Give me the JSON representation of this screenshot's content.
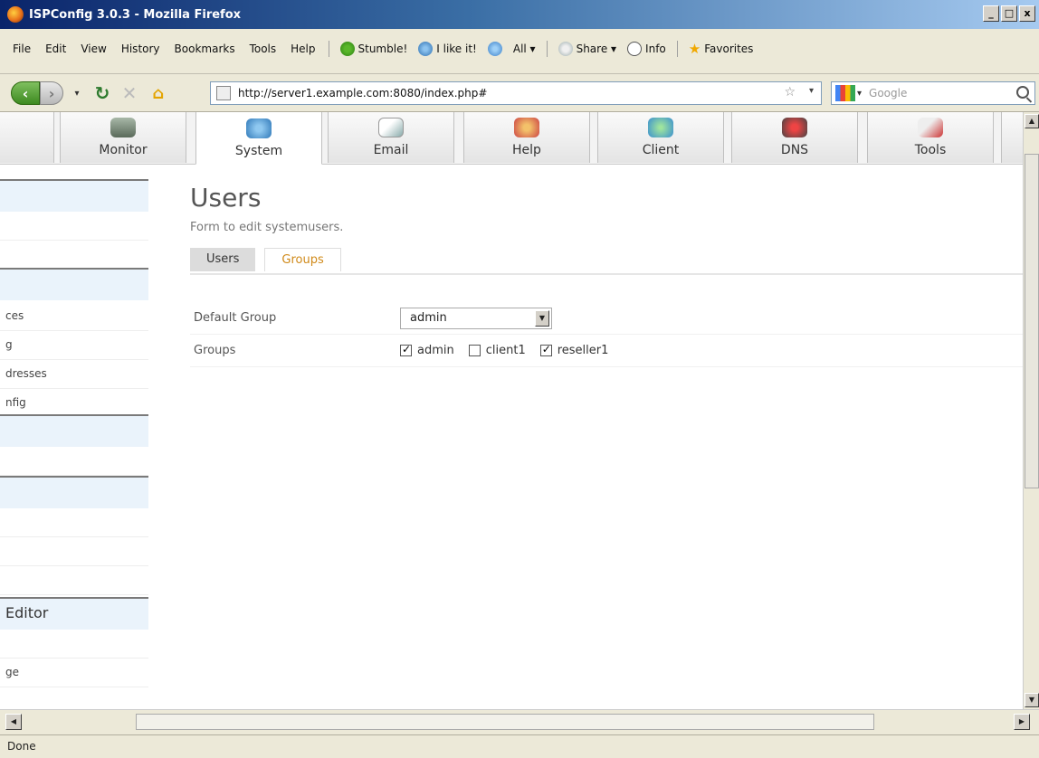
{
  "window": {
    "title": "ISPConfig 3.0.3 - Mozilla Firefox",
    "minimize_label": "_",
    "maximize_label": "□",
    "close_label": "x"
  },
  "menu": {
    "items": [
      "File",
      "Edit",
      "View",
      "History",
      "Bookmarks",
      "Tools",
      "Help"
    ],
    "toolbar": {
      "stumble": "Stumble!",
      "ilike": "I like it!",
      "all": "All ▾",
      "share": "Share ▾",
      "info": "Info",
      "favorites": "Favorites"
    }
  },
  "nav": {
    "url": "http://server1.example.com:8080/index.php#",
    "search_placeholder": "Google"
  },
  "modules": {
    "tabs": [
      {
        "label": "Monitor",
        "icon": "monitor-icon"
      },
      {
        "label": "System",
        "icon": "system-icon"
      },
      {
        "label": "Email",
        "icon": "email-icon"
      },
      {
        "label": "Help",
        "icon": "help-icon"
      },
      {
        "label": "Client",
        "icon": "client-icon"
      },
      {
        "label": "DNS",
        "icon": "dns-icon"
      },
      {
        "label": "Tools",
        "icon": "tools-icon"
      }
    ],
    "active": "System"
  },
  "sidebar": {
    "items": [
      "ces",
      "g",
      "dresses",
      "nfig",
      "Editor",
      "ge"
    ]
  },
  "page": {
    "title": "Users",
    "description": "Form to edit systemusers.",
    "tabs": {
      "users": "Users",
      "groups": "Groups"
    }
  },
  "form": {
    "default_group_label": "Default Group",
    "default_group_value": "admin",
    "groups_label": "Groups",
    "groups": [
      {
        "name": "admin",
        "checked": true
      },
      {
        "name": "client1",
        "checked": false
      },
      {
        "name": "reseller1",
        "checked": true
      }
    ]
  },
  "status": {
    "text": "Done"
  }
}
